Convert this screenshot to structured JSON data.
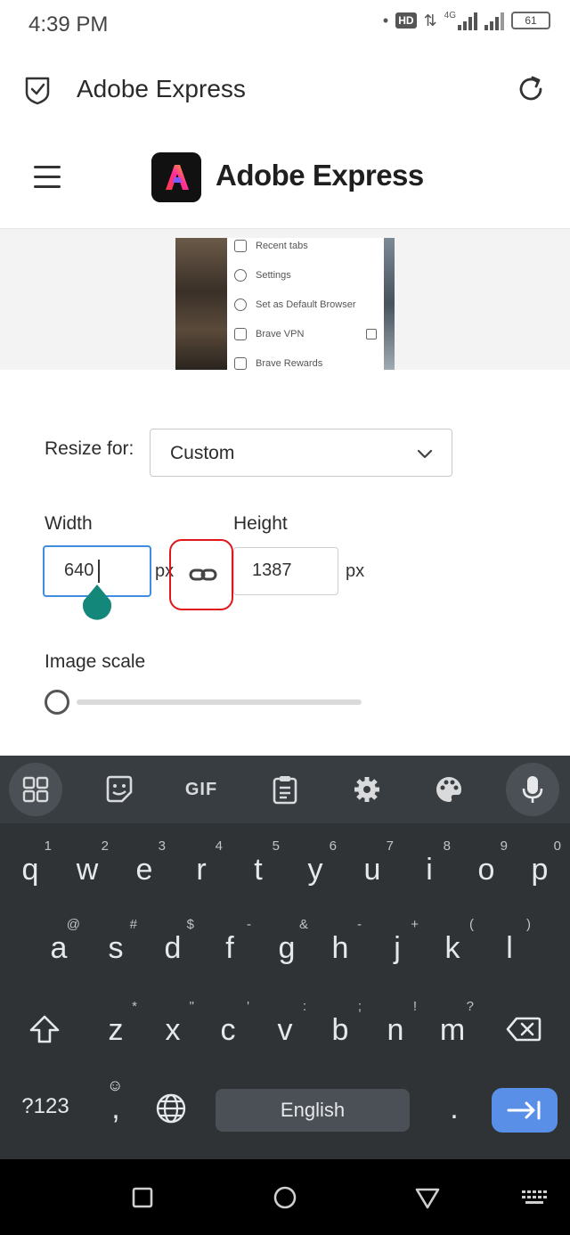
{
  "status_bar": {
    "time": "4:39 PM",
    "network": "4G",
    "hd": "HD",
    "battery": "61"
  },
  "tab_bar": {
    "title": "Adobe Express"
  },
  "site_header": {
    "brand": "Adobe Express"
  },
  "preview": {
    "menu_items": [
      "Recent tabs",
      "Settings",
      "Set as Default Browser",
      "Brave VPN",
      "Brave Rewards"
    ]
  },
  "form": {
    "resize_label": "Resize for:",
    "resize_value": "Custom",
    "width_label": "Width",
    "width_value": "640",
    "width_unit": "px",
    "height_label": "Height",
    "height_value": "1387",
    "height_unit": "px",
    "scale_label": "Image scale",
    "scale_level": 0
  },
  "keyboard": {
    "row1": [
      {
        "k": "q",
        "h": "1"
      },
      {
        "k": "w",
        "h": "2"
      },
      {
        "k": "e",
        "h": "3"
      },
      {
        "k": "r",
        "h": "4"
      },
      {
        "k": "t",
        "h": "5"
      },
      {
        "k": "y",
        "h": "6"
      },
      {
        "k": "u",
        "h": "7"
      },
      {
        "k": "i",
        "h": "8"
      },
      {
        "k": "o",
        "h": "9"
      },
      {
        "k": "p",
        "h": "0"
      }
    ],
    "row2": [
      {
        "k": "a",
        "h": "@"
      },
      {
        "k": "s",
        "h": "#"
      },
      {
        "k": "d",
        "h": "$"
      },
      {
        "k": "f",
        "h": "-"
      },
      {
        "k": "g",
        "h": "&"
      },
      {
        "k": "h",
        "h": "-"
      },
      {
        "k": "j",
        "h": "+"
      },
      {
        "k": "k",
        "h": "("
      },
      {
        "k": "l",
        "h": ")"
      }
    ],
    "row3": [
      {
        "k": "z",
        "h": "*"
      },
      {
        "k": "x",
        "h": "\""
      },
      {
        "k": "c",
        "h": "'"
      },
      {
        "k": "v",
        "h": ":"
      },
      {
        "k": "b",
        "h": ";"
      },
      {
        "k": "n",
        "h": "!"
      },
      {
        "k": "m",
        "h": "?"
      }
    ],
    "symbols_label": "?123",
    "comma_label": ",",
    "period_label": ".",
    "space_label": "English",
    "toolbar": {
      "gif_label": "GIF"
    }
  },
  "colors": {
    "accent": "#3f8de0",
    "highlight": "#e0161b",
    "handle": "#13877a",
    "enter_key": "#5a8fe8"
  }
}
